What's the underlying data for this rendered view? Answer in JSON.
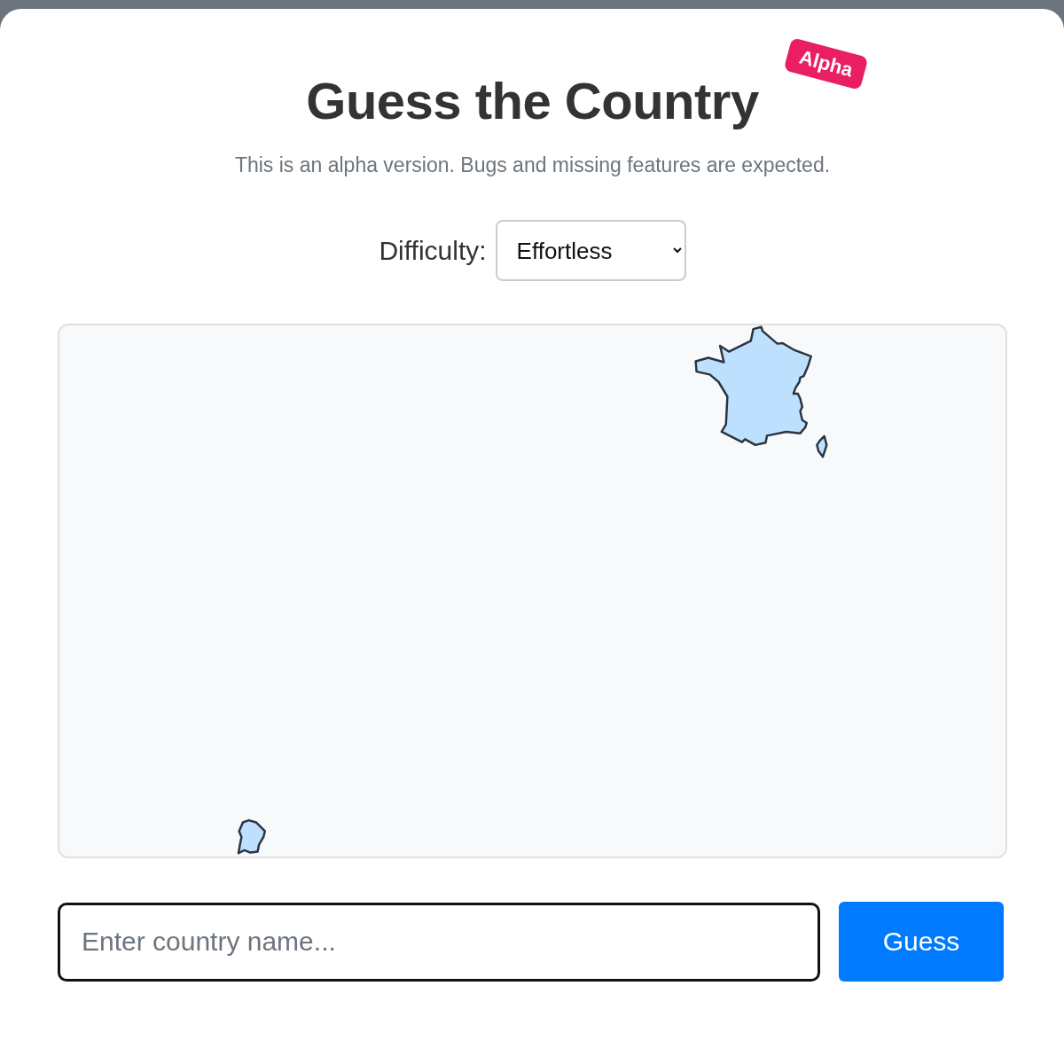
{
  "header": {
    "title": "Guess the Country",
    "badge": "Alpha",
    "subtitle": "This is an alpha version. Bugs and missing features are expected."
  },
  "difficulty": {
    "label": "Difficulty:",
    "value": "Effortless"
  },
  "guess": {
    "placeholder": "Enter country name...",
    "button": "Guess"
  }
}
